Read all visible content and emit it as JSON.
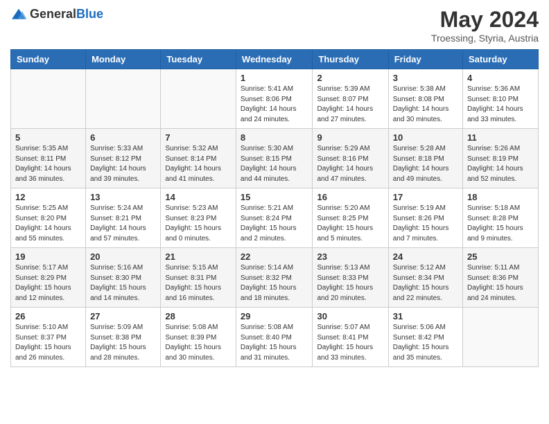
{
  "header": {
    "logo_general": "General",
    "logo_blue": "Blue",
    "month_year": "May 2024",
    "location": "Troessing, Styria, Austria"
  },
  "days_of_week": [
    "Sunday",
    "Monday",
    "Tuesday",
    "Wednesday",
    "Thursday",
    "Friday",
    "Saturday"
  ],
  "weeks": [
    [
      {
        "day": "",
        "detail": ""
      },
      {
        "day": "",
        "detail": ""
      },
      {
        "day": "",
        "detail": ""
      },
      {
        "day": "1",
        "detail": "Sunrise: 5:41 AM\nSunset: 8:06 PM\nDaylight: 14 hours\nand 24 minutes."
      },
      {
        "day": "2",
        "detail": "Sunrise: 5:39 AM\nSunset: 8:07 PM\nDaylight: 14 hours\nand 27 minutes."
      },
      {
        "day": "3",
        "detail": "Sunrise: 5:38 AM\nSunset: 8:08 PM\nDaylight: 14 hours\nand 30 minutes."
      },
      {
        "day": "4",
        "detail": "Sunrise: 5:36 AM\nSunset: 8:10 PM\nDaylight: 14 hours\nand 33 minutes."
      }
    ],
    [
      {
        "day": "5",
        "detail": "Sunrise: 5:35 AM\nSunset: 8:11 PM\nDaylight: 14 hours\nand 36 minutes."
      },
      {
        "day": "6",
        "detail": "Sunrise: 5:33 AM\nSunset: 8:12 PM\nDaylight: 14 hours\nand 39 minutes."
      },
      {
        "day": "7",
        "detail": "Sunrise: 5:32 AM\nSunset: 8:14 PM\nDaylight: 14 hours\nand 41 minutes."
      },
      {
        "day": "8",
        "detail": "Sunrise: 5:30 AM\nSunset: 8:15 PM\nDaylight: 14 hours\nand 44 minutes."
      },
      {
        "day": "9",
        "detail": "Sunrise: 5:29 AM\nSunset: 8:16 PM\nDaylight: 14 hours\nand 47 minutes."
      },
      {
        "day": "10",
        "detail": "Sunrise: 5:28 AM\nSunset: 8:18 PM\nDaylight: 14 hours\nand 49 minutes."
      },
      {
        "day": "11",
        "detail": "Sunrise: 5:26 AM\nSunset: 8:19 PM\nDaylight: 14 hours\nand 52 minutes."
      }
    ],
    [
      {
        "day": "12",
        "detail": "Sunrise: 5:25 AM\nSunset: 8:20 PM\nDaylight: 14 hours\nand 55 minutes."
      },
      {
        "day": "13",
        "detail": "Sunrise: 5:24 AM\nSunset: 8:21 PM\nDaylight: 14 hours\nand 57 minutes."
      },
      {
        "day": "14",
        "detail": "Sunrise: 5:23 AM\nSunset: 8:23 PM\nDaylight: 15 hours\nand 0 minutes."
      },
      {
        "day": "15",
        "detail": "Sunrise: 5:21 AM\nSunset: 8:24 PM\nDaylight: 15 hours\nand 2 minutes."
      },
      {
        "day": "16",
        "detail": "Sunrise: 5:20 AM\nSunset: 8:25 PM\nDaylight: 15 hours\nand 5 minutes."
      },
      {
        "day": "17",
        "detail": "Sunrise: 5:19 AM\nSunset: 8:26 PM\nDaylight: 15 hours\nand 7 minutes."
      },
      {
        "day": "18",
        "detail": "Sunrise: 5:18 AM\nSunset: 8:28 PM\nDaylight: 15 hours\nand 9 minutes."
      }
    ],
    [
      {
        "day": "19",
        "detail": "Sunrise: 5:17 AM\nSunset: 8:29 PM\nDaylight: 15 hours\nand 12 minutes."
      },
      {
        "day": "20",
        "detail": "Sunrise: 5:16 AM\nSunset: 8:30 PM\nDaylight: 15 hours\nand 14 minutes."
      },
      {
        "day": "21",
        "detail": "Sunrise: 5:15 AM\nSunset: 8:31 PM\nDaylight: 15 hours\nand 16 minutes."
      },
      {
        "day": "22",
        "detail": "Sunrise: 5:14 AM\nSunset: 8:32 PM\nDaylight: 15 hours\nand 18 minutes."
      },
      {
        "day": "23",
        "detail": "Sunrise: 5:13 AM\nSunset: 8:33 PM\nDaylight: 15 hours\nand 20 minutes."
      },
      {
        "day": "24",
        "detail": "Sunrise: 5:12 AM\nSunset: 8:34 PM\nDaylight: 15 hours\nand 22 minutes."
      },
      {
        "day": "25",
        "detail": "Sunrise: 5:11 AM\nSunset: 8:36 PM\nDaylight: 15 hours\nand 24 minutes."
      }
    ],
    [
      {
        "day": "26",
        "detail": "Sunrise: 5:10 AM\nSunset: 8:37 PM\nDaylight: 15 hours\nand 26 minutes."
      },
      {
        "day": "27",
        "detail": "Sunrise: 5:09 AM\nSunset: 8:38 PM\nDaylight: 15 hours\nand 28 minutes."
      },
      {
        "day": "28",
        "detail": "Sunrise: 5:08 AM\nSunset: 8:39 PM\nDaylight: 15 hours\nand 30 minutes."
      },
      {
        "day": "29",
        "detail": "Sunrise: 5:08 AM\nSunset: 8:40 PM\nDaylight: 15 hours\nand 31 minutes."
      },
      {
        "day": "30",
        "detail": "Sunrise: 5:07 AM\nSunset: 8:41 PM\nDaylight: 15 hours\nand 33 minutes."
      },
      {
        "day": "31",
        "detail": "Sunrise: 5:06 AM\nSunset: 8:42 PM\nDaylight: 15 hours\nand 35 minutes."
      },
      {
        "day": "",
        "detail": ""
      }
    ]
  ]
}
